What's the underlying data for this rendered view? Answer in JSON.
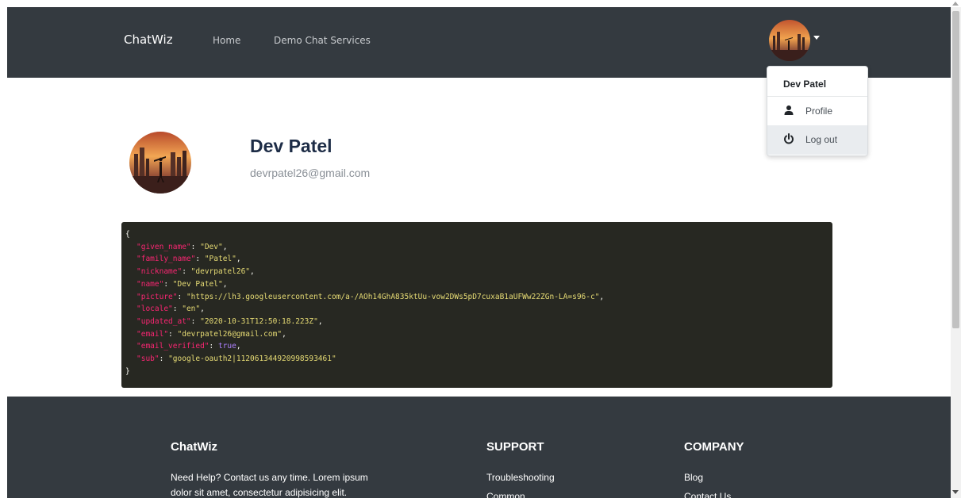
{
  "navbar": {
    "brand": "ChatWiz",
    "links": [
      "Home",
      "Demo Chat Services"
    ],
    "avatar_icon": "user-avatar-icon"
  },
  "dropdown": {
    "header": "Dev Patel",
    "items": [
      {
        "label": "Profile",
        "icon": "user-icon"
      },
      {
        "label": "Log out",
        "icon": "power-icon"
      }
    ]
  },
  "profile": {
    "name": "Dev Patel",
    "email": "devrpatel26@gmail.com"
  },
  "json_code": {
    "open_brace": "{",
    "close_brace": "}",
    "entries": [
      {
        "key": "\"given_name\"",
        "value": "\"Dev\"",
        "type": "string"
      },
      {
        "key": "\"family_name\"",
        "value": "\"Patel\"",
        "type": "string"
      },
      {
        "key": "\"nickname\"",
        "value": "\"devrpatel26\"",
        "type": "string"
      },
      {
        "key": "\"name\"",
        "value": "\"Dev Patel\"",
        "type": "string"
      },
      {
        "key": "\"picture\"",
        "value": "\"https://lh3.googleusercontent.com/a-/AOh14GhA835ktUu-vow2DWs5pD7cuxaB1aUFWw22ZGn-LA=s96-c\"",
        "type": "string"
      },
      {
        "key": "\"locale\"",
        "value": "\"en\"",
        "type": "string"
      },
      {
        "key": "\"updated_at\"",
        "value": "\"2020-10-31T12:50:18.223Z\"",
        "type": "string"
      },
      {
        "key": "\"email\"",
        "value": "\"devrpatel26@gmail.com\"",
        "type": "string"
      },
      {
        "key": "\"email_verified\"",
        "value": "true",
        "type": "bool"
      },
      {
        "key": "\"sub\"",
        "value": "\"google-oauth2|112061344920998593461\"",
        "type": "string"
      }
    ]
  },
  "footer": {
    "about_title": "ChatWiz",
    "about_line1": "Need Help? Contact us any time. Lorem ipsum",
    "about_line2": "dolor sit amet, consectetur adipisicing elit.",
    "support_title": "SUPPORT",
    "support_links": [
      "Troubleshooting",
      "Common"
    ],
    "company_title": "COMPANY",
    "company_links": [
      "Blog",
      "Contact Us"
    ]
  },
  "colors": {
    "navbar_bg": "#343a40",
    "code_bg": "#272822",
    "code_key": "#f92672",
    "code_string": "#e6db74",
    "code_bool": "#ae81ff"
  }
}
